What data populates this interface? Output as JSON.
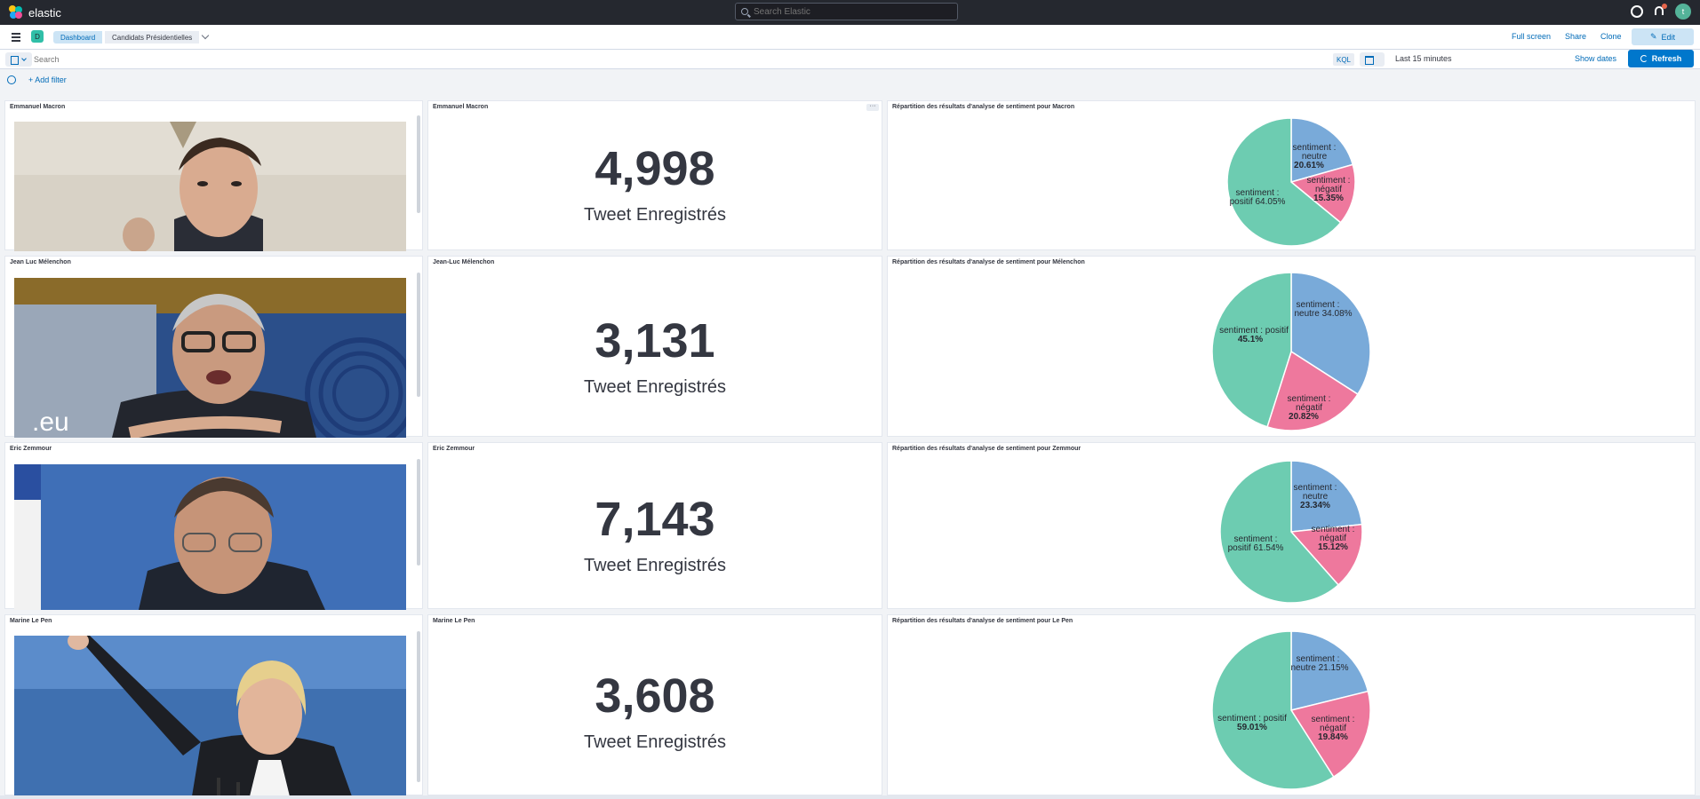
{
  "app": {
    "name": "elastic"
  },
  "header": {
    "search_placeholder": "Search Elastic",
    "avatar_initial": "t"
  },
  "nav": {
    "space_initial": "D",
    "breadcrumbs": [
      "Dashboard",
      "Candidats Présidentielles"
    ],
    "actions": {
      "full_screen": "Full screen",
      "share": "Share",
      "clone": "Clone",
      "edit": "Edit"
    }
  },
  "query": {
    "placeholder": "Search",
    "language": "KQL",
    "time_range": "Last 15 minutes",
    "show_dates": "Show dates",
    "refresh": "Refresh",
    "add_filter": "+ Add filter"
  },
  "colors": {
    "neutre": "#79aad9",
    "negatif": "#ee789d",
    "positif": "#6dccb1",
    "accent": "#0077cc"
  },
  "rows": [
    {
      "image_title": "Emmanuel Macron",
      "metric_title": "Emmanuel Macron",
      "metric_value": "4,998",
      "metric_label": "Tweet Enregistrés",
      "pie_title": "Répartition des résultats d'analyse de sentiment pour Macron",
      "pie_labels": {
        "neutre": [
          "sentiment :",
          "neutre",
          "20.61%"
        ],
        "negatif": [
          "sentiment :",
          "négatif",
          "15.35%"
        ],
        "positif": [
          "sentiment :",
          "positif 64.05%"
        ]
      }
    },
    {
      "image_title": "Jean Luc Mélenchon",
      "metric_title": "Jean-Luc Mélenchon",
      "metric_value": "3,131",
      "metric_label": "Tweet Enregistrés",
      "pie_title": "Répartition des résultats d'analyse de sentiment pour Mélenchon",
      "pie_labels": {
        "neutre": [
          "sentiment :",
          "neutre 34.08%"
        ],
        "negatif": [
          "sentiment :",
          "négatif",
          "20.82%"
        ],
        "positif": [
          "sentiment : positif",
          "45.1%"
        ]
      }
    },
    {
      "image_title": "Eric Zemmour",
      "metric_title": "Eric Zemmour",
      "metric_value": "7,143",
      "metric_label": "Tweet Enregistrés",
      "pie_title": "Répartition des résultats d'analyse de sentiment pour Zemmour",
      "pie_labels": {
        "neutre": [
          "sentiment :",
          "neutre",
          "23.34%"
        ],
        "negatif": [
          "sentiment :",
          "négatif",
          "15.12%"
        ],
        "positif": [
          "sentiment :",
          "positif 61.54%"
        ]
      }
    },
    {
      "image_title": "Marine Le Pen",
      "metric_title": "Marine Le Pen",
      "metric_value": "3,608",
      "metric_label": "Tweet Enregistrés",
      "pie_title": "Répartition des résultats d'analyse de sentiment pour Le Pen",
      "pie_labels": {
        "neutre": [
          "sentiment :",
          "neutre 21.15%"
        ],
        "negatif": [
          "sentiment :",
          "négatif",
          "19.84%"
        ],
        "positif": [
          "sentiment : positif",
          "59.01%"
        ]
      }
    }
  ],
  "chart_data": [
    {
      "type": "pie",
      "title": "Répartition des résultats d'analyse de sentiment pour Macron",
      "categories": [
        "sentiment : neutre",
        "sentiment : négatif",
        "sentiment : positif"
      ],
      "values": [
        20.61,
        15.35,
        64.05
      ]
    },
    {
      "type": "pie",
      "title": "Répartition des résultats d'analyse de sentiment pour Mélenchon",
      "categories": [
        "sentiment : neutre",
        "sentiment : négatif",
        "sentiment : positif"
      ],
      "values": [
        34.08,
        20.82,
        45.1
      ]
    },
    {
      "type": "pie",
      "title": "Répartition des résultats d'analyse de sentiment pour Zemmour",
      "categories": [
        "sentiment : neutre",
        "sentiment : négatif",
        "sentiment : positif"
      ],
      "values": [
        23.34,
        15.12,
        61.54
      ]
    },
    {
      "type": "pie",
      "title": "Répartition des résultats d'analyse de sentiment pour Le Pen",
      "categories": [
        "sentiment : neutre",
        "sentiment : négatif",
        "sentiment : positif"
      ],
      "values": [
        21.15,
        19.84,
        59.01
      ]
    }
  ]
}
